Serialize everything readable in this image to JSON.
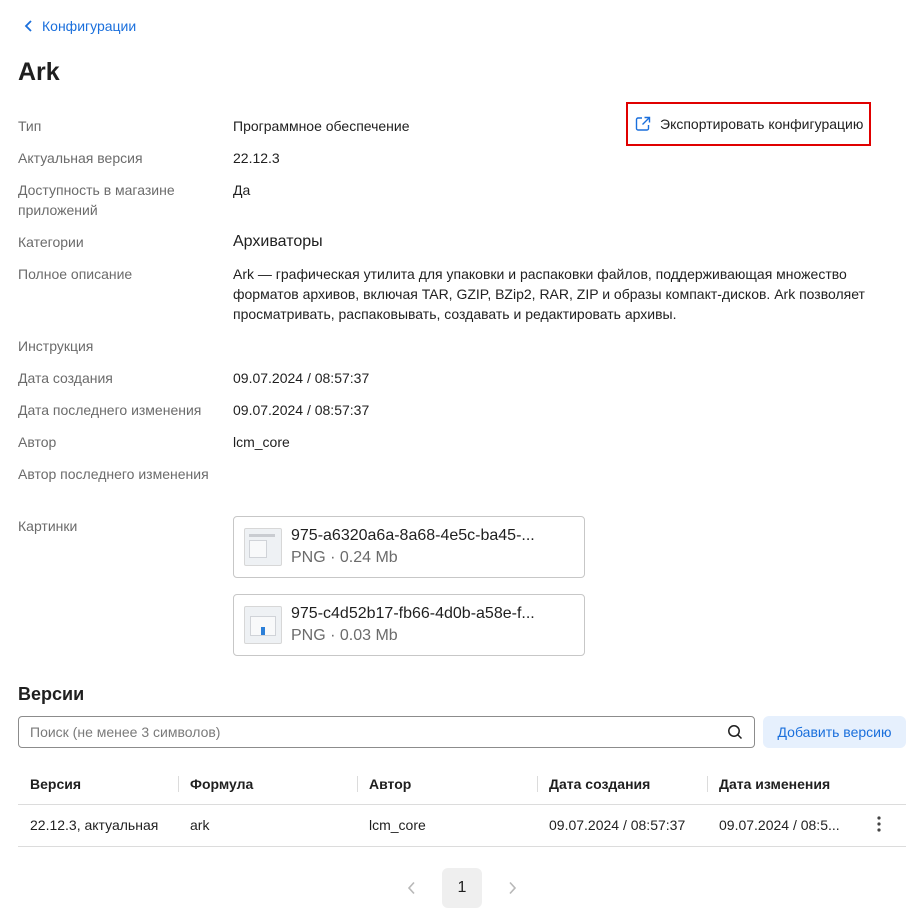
{
  "nav": {
    "back_label": "Конфигурации"
  },
  "page": {
    "title": "Ark"
  },
  "export": {
    "label": "Экспортировать конфигурацию"
  },
  "props": {
    "type": {
      "key": "Тип",
      "value": "Программное обеспечение"
    },
    "current_version": {
      "key": "Актуальная версия",
      "value": "22.12.3"
    },
    "store": {
      "key": "Доступность в магазине приложений",
      "value": "Да"
    },
    "categories": {
      "key": "Категории",
      "value": "Архиваторы"
    },
    "full_description": {
      "key": "Полное описание",
      "value": "Ark — графическая утилита для упаковки и распаковки файлов, поддерживающая множество форматов архивов, включая TAR, GZIP, BZip2, RAR, ZIP и образы компакт-дисков. Ark позволяет просматривать, распаковывать, создавать и редактировать архивы."
    },
    "instruction": {
      "key": "Инструкция",
      "value": ""
    },
    "created": {
      "key": "Дата создания",
      "value": "09.07.2024 / 08:57:37"
    },
    "modified": {
      "key": "Дата последнего изменения",
      "value": "09.07.2024 / 08:57:37"
    },
    "author": {
      "key": "Автор",
      "value": "lcm_core"
    },
    "last_author": {
      "key": "Автор последнего изменения",
      "value": ""
    },
    "images_key": "Картинки"
  },
  "images": [
    {
      "name": "975-a6320a6a-8a68-4e5c-ba45-...",
      "meta": "PNG · 0.24 Mb"
    },
    {
      "name": "975-c4d52b17-fb66-4d0b-a58e-f...",
      "meta": "PNG · 0.03 Mb"
    }
  ],
  "versions": {
    "title": "Версии",
    "search_placeholder": "Поиск (не менее 3 символов)",
    "add_label": "Добавить версию",
    "columns": [
      "Версия",
      "Формула",
      "Автор",
      "Дата создания",
      "Дата изменения"
    ],
    "rows": [
      {
        "version": "22.12.3, актуальная",
        "formula": "ark",
        "author": "lcm_core",
        "created": "09.07.2024 / 08:57:37",
        "modified": "09.07.2024 / 08:5..."
      }
    ]
  },
  "pagination": {
    "current": "1"
  },
  "colors": {
    "accent": "#1a6fdc",
    "highlight_border": "#e00000"
  },
  "icons": {
    "back": "chevron-left-icon",
    "export": "export-icon",
    "search": "search-icon",
    "more": "more-vertical-icon"
  }
}
